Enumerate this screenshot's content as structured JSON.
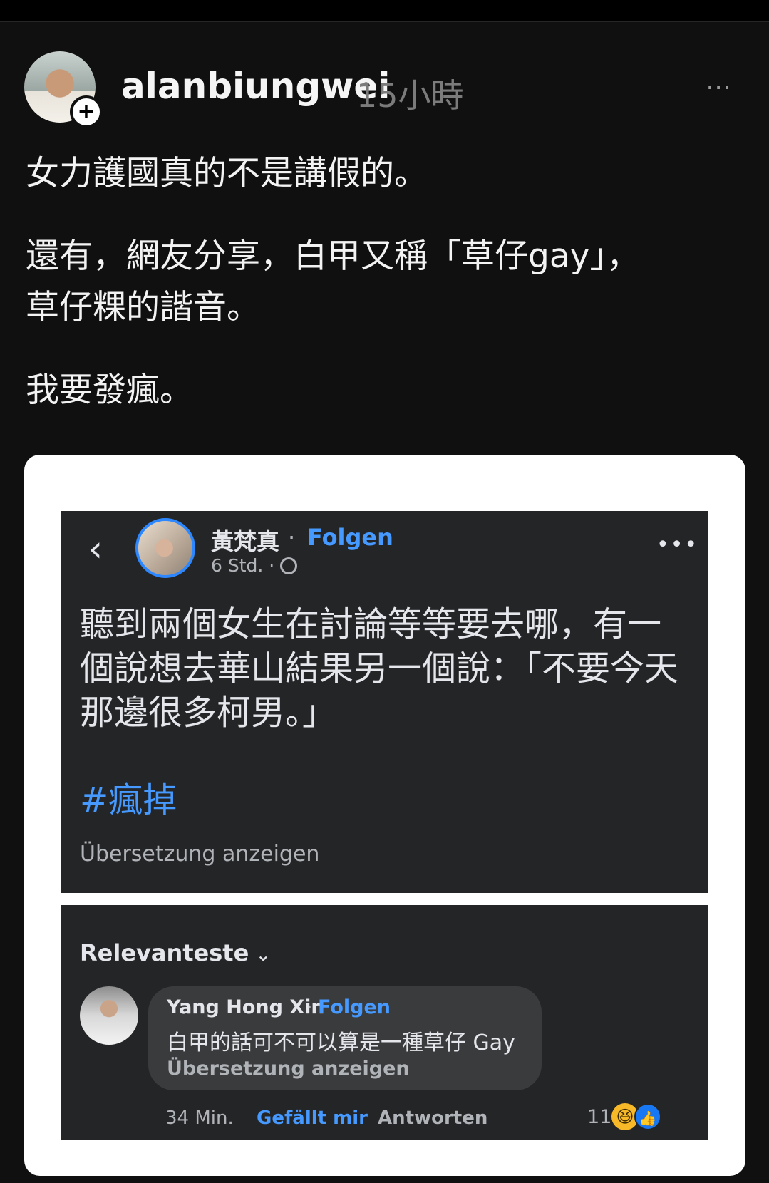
{
  "post": {
    "username": "alanbiungwei",
    "time": "15小時",
    "more_icon": "⋯",
    "add_icon": "+",
    "lines": [
      "女力護國真的不是講假的。",
      "還有，網友分享，白甲又稱「草仔gay」，",
      "草仔粿的諧音。",
      "我要發瘋。"
    ]
  },
  "embedded": {
    "fb_post": {
      "back_icon": "‹",
      "name": "黃梵真",
      "sep": "·",
      "follow": "Folgen",
      "meta": "6 Std. ·",
      "more_icon": "•••",
      "body": "聽到兩個女生在討論等等要去哪，有一個說想去華山結果另一個說：「不要今天那邊很多柯男。」",
      "hashtag": "#瘋掉",
      "translate": "Übersetzung anzeigen"
    },
    "comments": {
      "sort": "Relevanteste",
      "chevron": "⌄",
      "comment": {
        "name": "Yang Hong Xin",
        "sep": "·",
        "follow": "Folgen",
        "text": "白甲的話可不可以算是一種草仔 Gay",
        "translate": "Übersetzung anzeigen",
        "time": "34 Min.",
        "like": "Gefällt mir",
        "reply": "Antworten",
        "reaction_count": "11",
        "haha_icon": "😆",
        "like_icon": "👍"
      }
    }
  }
}
